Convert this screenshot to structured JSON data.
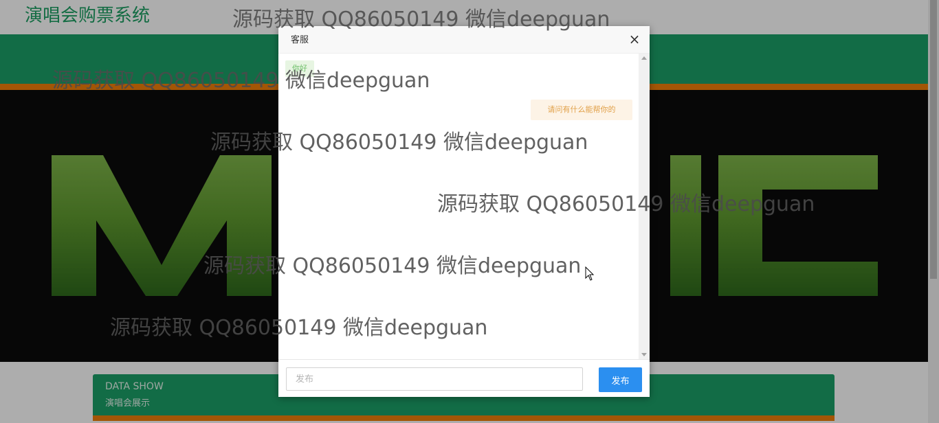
{
  "site": {
    "title": "演唱会购票系统"
  },
  "banner": {
    "word": "MUSIC"
  },
  "data_show": {
    "title_en": "DATA SHOW",
    "title_cn": "演唱会展示"
  },
  "dialog": {
    "title": "客服",
    "close_symbol": "×",
    "messages": [
      {
        "side": "left",
        "text": "你好"
      },
      {
        "side": "right",
        "text": "请问有什么能帮你的"
      }
    ],
    "input_placeholder": "发布",
    "submit_label": "发布"
  },
  "watermark": "源码获取 QQ86050149 微信deepguan",
  "colors": {
    "brand_green": "#1ba067",
    "accent_orange": "#f07f0a",
    "button_blue": "#2b8ff0"
  }
}
